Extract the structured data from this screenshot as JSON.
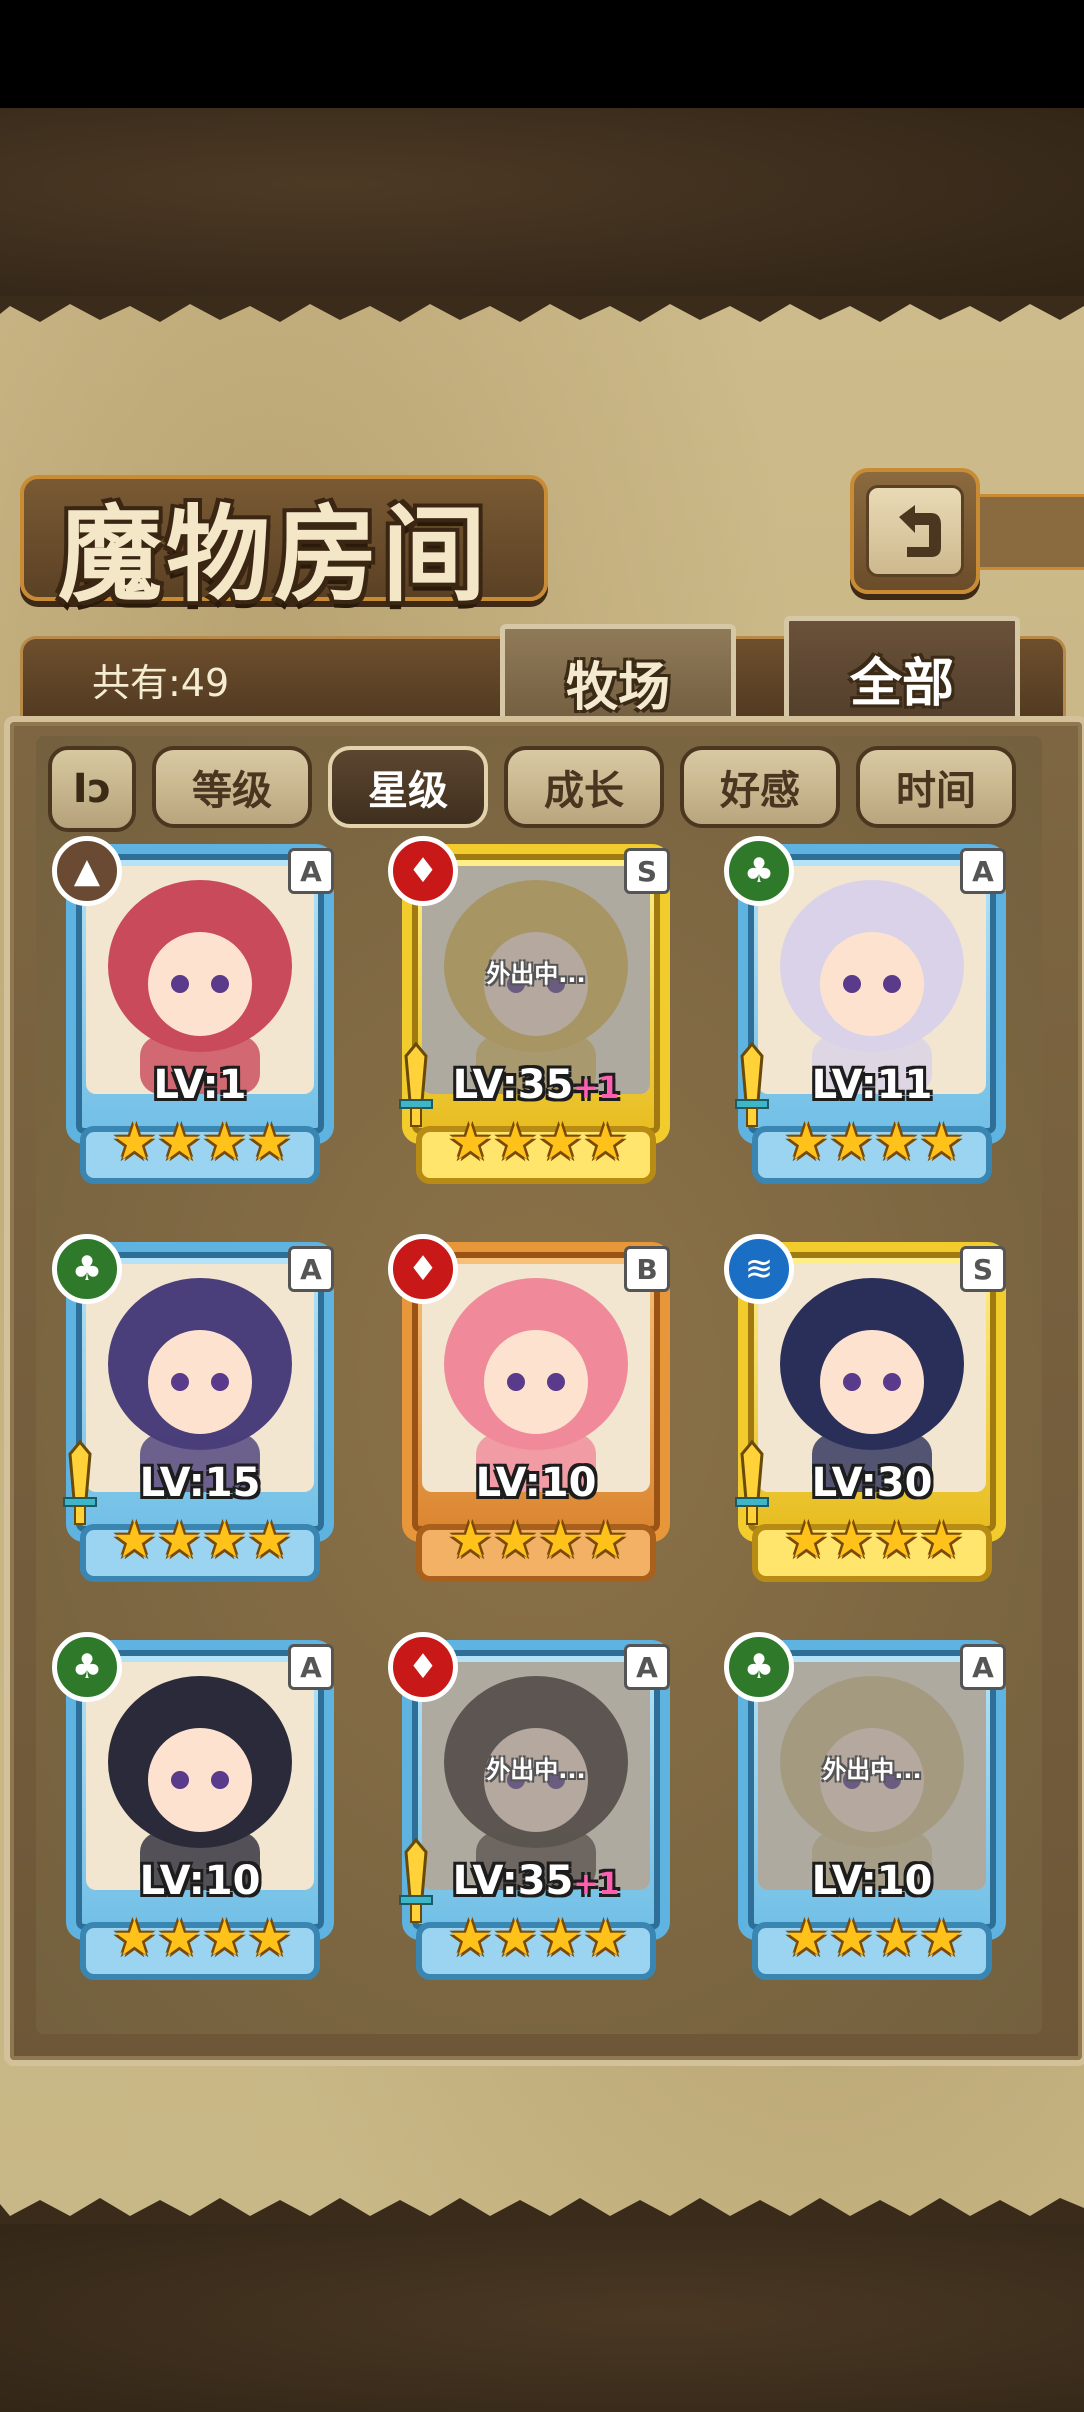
{
  "header": {
    "title": "魔物房间",
    "back_icon": "back-arrow-icon"
  },
  "tabs": {
    "count_label": "共有:49",
    "ranch": "牧场",
    "all": "全部",
    "active": "all"
  },
  "sort": {
    "toggle_symbol": "Iↄ",
    "buttons": [
      "等级",
      "星级",
      "成长",
      "好感",
      "时间"
    ],
    "active_index": 1
  },
  "monsters": [
    {
      "element": "earth",
      "rank": "A",
      "level": "LV:1",
      "bonus": "",
      "stars": 4,
      "away": "",
      "weapon": false,
      "frame": "blue"
    },
    {
      "element": "fire",
      "rank": "S",
      "level": "LV:35",
      "bonus": "+1",
      "stars": 4,
      "away": "外出中...",
      "weapon": true,
      "frame": "gold"
    },
    {
      "element": "nature",
      "rank": "A",
      "level": "LV:11",
      "bonus": "",
      "stars": 4,
      "away": "",
      "weapon": true,
      "frame": "blue"
    },
    {
      "element": "nature",
      "rank": "A",
      "level": "LV:15",
      "bonus": "",
      "stars": 4,
      "away": "",
      "weapon": true,
      "frame": "blue"
    },
    {
      "element": "fire",
      "rank": "B",
      "level": "LV:10",
      "bonus": "",
      "stars": 4,
      "away": "",
      "weapon": false,
      "frame": "orange"
    },
    {
      "element": "water",
      "rank": "S",
      "level": "LV:30",
      "bonus": "",
      "stars": 4,
      "away": "",
      "weapon": true,
      "frame": "gold"
    },
    {
      "element": "nature",
      "rank": "A",
      "level": "LV:10",
      "bonus": "",
      "stars": 4,
      "away": "",
      "weapon": false,
      "frame": "blue"
    },
    {
      "element": "fire",
      "rank": "A",
      "level": "LV:35",
      "bonus": "+1",
      "stars": 4,
      "away": "外出中...",
      "weapon": true,
      "frame": "blue"
    },
    {
      "element": "nature",
      "rank": "A",
      "level": "LV:10",
      "bonus": "",
      "stars": 4,
      "away": "外出中...",
      "weapon": false,
      "frame": "blue"
    }
  ],
  "colors": {
    "earth": "#6b4a33",
    "fire": "#c81818",
    "nature": "#2f7a2a",
    "water": "#1a6fc4"
  }
}
